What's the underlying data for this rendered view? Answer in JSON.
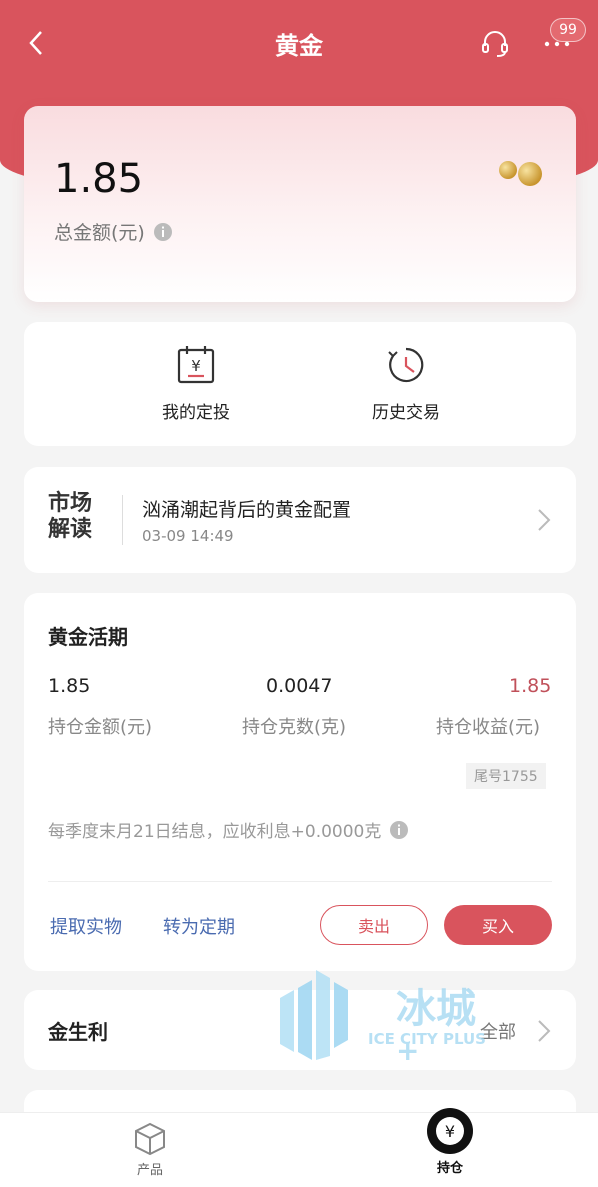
{
  "nav": {
    "title": "黄金",
    "badge": "99"
  },
  "summary": {
    "amount": "1.85",
    "label": "总金额(元)"
  },
  "actions": [
    {
      "label": "我的定投",
      "icon": "calendar-yen-icon"
    },
    {
      "label": "历史交易",
      "icon": "history-clock-icon"
    }
  ],
  "news": {
    "tag_line1": "市场",
    "tag_line2": "解读",
    "title": "汹涌潮起背后的黄金配置",
    "time": "03-09 14:49"
  },
  "gold_current": {
    "title": "黄金活期",
    "stats": [
      {
        "value": "1.85",
        "label": "持仓金额(元)"
      },
      {
        "value": "0.0047",
        "label": "持仓克数(克)"
      },
      {
        "value": "1.85",
        "label": "持仓收益(元)",
        "color": "#c0505a"
      }
    ],
    "tail_no": "尾号1755",
    "interest_note": "每季度末月21日结息，应收利息+0.0000克",
    "links": [
      "提取实物",
      "转为定期"
    ],
    "sell_label": "卖出",
    "buy_label": "买入"
  },
  "jinshengli": {
    "title": "金生利",
    "all_label": "全部"
  },
  "tabbar": [
    {
      "label": "产品",
      "icon": "box-icon"
    },
    {
      "label": "持仓",
      "icon": "yen-circle-icon"
    }
  ],
  "watermark": {
    "text": "冰城",
    "plus": "+",
    "sub": "ICE CITY PLUS"
  },
  "colors": {
    "accent": "#d9545d",
    "link": "#4a6bb0"
  }
}
